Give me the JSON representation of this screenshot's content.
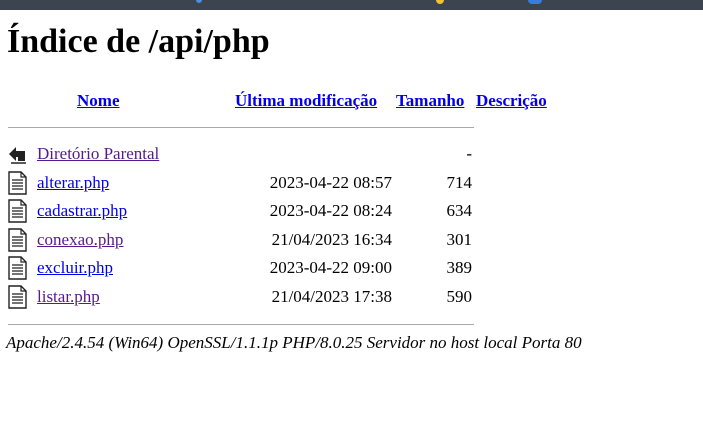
{
  "page": {
    "title": "Índice de /api/php"
  },
  "table": {
    "headers": {
      "name": "Nome",
      "modified": "Última modificação",
      "size": "Tamanho",
      "description": "Descrição"
    },
    "parent": {
      "label": "Diretório Parental",
      "size": "-",
      "icon": "back-folder-icon"
    },
    "files": [
      {
        "name": "alterar.php",
        "modified": "2023-04-22 08:57",
        "size": "714",
        "visited": false,
        "icon": "text-file-icon"
      },
      {
        "name": "cadastrar.php",
        "modified": "2023-04-22 08:24",
        "size": "634",
        "visited": false,
        "icon": "text-file-icon"
      },
      {
        "name": "conexao.php",
        "modified": "21/04/2023 16:34",
        "size": "301",
        "visited": true,
        "icon": "text-file-icon"
      },
      {
        "name": "excluir.php",
        "modified": "2023-04-22 09:00",
        "size": "389",
        "visited": false,
        "icon": "text-file-icon"
      },
      {
        "name": "listar.php",
        "modified": "21/04/2023 17:38",
        "size": "590",
        "visited": true,
        "icon": "text-file-icon"
      }
    ]
  },
  "footer": {
    "address": "Apache/2.4.54 (Win64) OpenSSL/1.1.1p PHP/8.0.25 Servidor no host local Porta 80"
  },
  "colors": {
    "link": "#0000ee",
    "visited": "#551a8b",
    "topbar": "#3c4450"
  }
}
